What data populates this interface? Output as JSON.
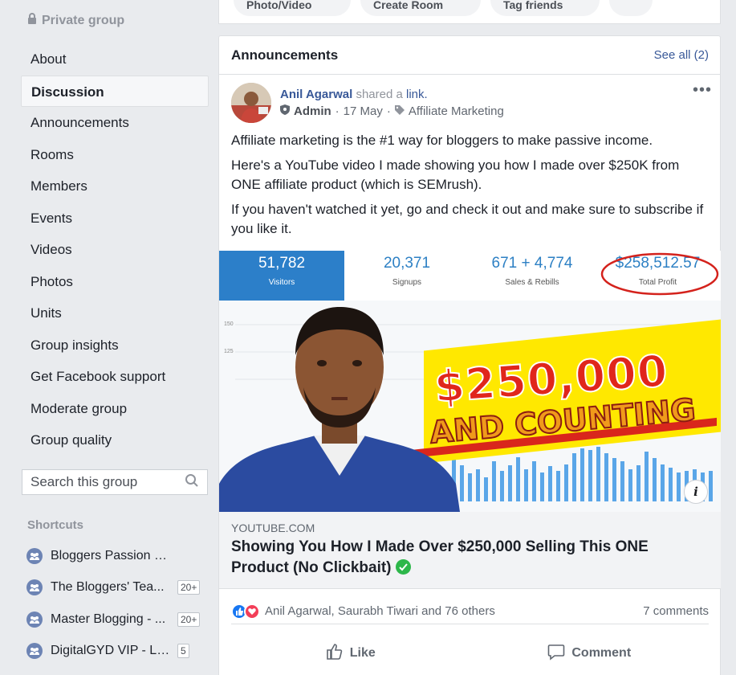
{
  "group": {
    "privacy_label": "Private group"
  },
  "sidebar": {
    "items": [
      {
        "label": "About"
      },
      {
        "label": "Discussion",
        "active": true
      },
      {
        "label": "Announcements"
      },
      {
        "label": "Rooms"
      },
      {
        "label": "Members"
      },
      {
        "label": "Events"
      },
      {
        "label": "Videos"
      },
      {
        "label": "Photos"
      },
      {
        "label": "Units"
      },
      {
        "label": "Group insights"
      },
      {
        "label": "Get Facebook support"
      },
      {
        "label": "Moderate group"
      },
      {
        "label": "Group quality"
      }
    ],
    "search_placeholder": "Search this group",
    "shortcuts_title": "Shortcuts",
    "shortcuts": [
      {
        "label": "Bloggers Passion VIP ...",
        "badge": ""
      },
      {
        "label": "The Bloggers' Tea...",
        "badge": "20+"
      },
      {
        "label": "Master Blogging - ...",
        "badge": "20+"
      },
      {
        "label": "DigitalGYD VIP - Lea...",
        "badge": "5"
      }
    ]
  },
  "top_actions": [
    "Photo/Video",
    "Create Room",
    "Tag friends"
  ],
  "announcements": {
    "title": "Announcements",
    "see_all": "See all (2)"
  },
  "post": {
    "author": "Anil Agarwal",
    "action": "shared a",
    "action_link": "link.",
    "role": "Admin",
    "date": "17 May",
    "topic": "Affiliate Marketing",
    "paragraphs": [
      "Affiliate marketing is the #1 way for bloggers to make passive income.",
      "Here's a YouTube video I made showing you how I made over $250K from ONE affiliate product (which is SEMrush).",
      "If you haven't watched it yet, go and check it out and make sure to subscribe if you like it."
    ],
    "thumbnail": {
      "stats": [
        {
          "value": "51,782",
          "label": "Visitors"
        },
        {
          "value": "20,371",
          "label": "Signups"
        },
        {
          "value": "671 + 4,774",
          "label": "Sales & Rebills"
        },
        {
          "value": "$258,512.57",
          "label": "Total Profit"
        }
      ],
      "y_ticks": [
        "150",
        "125"
      ],
      "headline_1": "$250,000",
      "headline_2": "AND COUNTING",
      "info_icon": "i"
    },
    "link": {
      "domain": "YOUTUBE.COM",
      "title": "Showing You How I Made Over $250,000 Selling This ONE Product (No Clickbait)"
    },
    "reactions_text": "Anil Agarwal, Saurabh Tiwari and 76 others",
    "comments_count": "7 comments",
    "like_label": "Like",
    "comment_label": "Comment"
  },
  "colors": {
    "link_blue": "#385898",
    "page_bg": "#e9ebee",
    "stat_blue": "#2c7fc9"
  }
}
